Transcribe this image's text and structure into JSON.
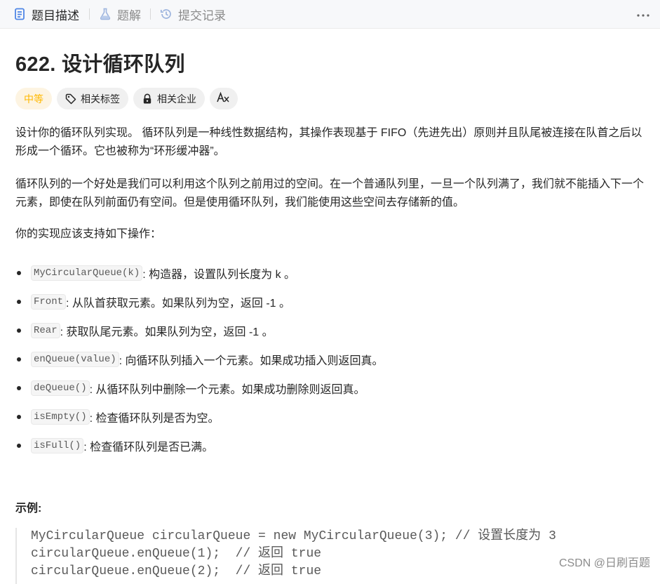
{
  "tabs": [
    {
      "label": "题目描述",
      "icon": "description-icon",
      "active": true
    },
    {
      "label": "题解",
      "icon": "flask-icon",
      "active": false
    },
    {
      "label": "提交记录",
      "icon": "history-icon",
      "active": false
    }
  ],
  "more_icon": "more-dots-icon",
  "problem": {
    "title": "622. 设计循环队列",
    "difficulty": "中等",
    "tags": [
      {
        "label": "相关标签",
        "icon": "tag-icon"
      },
      {
        "label": "相关企业",
        "icon": "lock-icon"
      }
    ],
    "translate_icon": "translate-icon"
  },
  "description": {
    "p1": "设计你的循环队列实现。 循环队列是一种线性数据结构，其操作表现基于 FIFO（先进先出）原则并且队尾被连接在队首之后以形成一个循环。它也被称为“环形缓冲器”。",
    "p2": "循环队列的一个好处是我们可以利用这个队列之前用过的空间。在一个普通队列里，一旦一个队列满了，我们就不能插入下一个元素，即使在队列前面仍有空间。但是使用循环队列，我们能使用这些空间去存储新的值。",
    "p3": "你的实现应该支持如下操作：",
    "operations": [
      {
        "code": "MyCircularQueue(k)",
        "text": ": 构造器，设置队列长度为 k 。"
      },
      {
        "code": "Front",
        "text": ": 从队首获取元素。如果队列为空，返回 -1 。"
      },
      {
        "code": "Rear",
        "text": ": 获取队尾元素。如果队列为空，返回 -1 。"
      },
      {
        "code": "enQueue(value)",
        "text": ": 向循环队列插入一个元素。如果成功插入则返回真。"
      },
      {
        "code": "deQueue()",
        "text": ": 从循环队列中删除一个元素。如果成功删除则返回真。"
      },
      {
        "code": "isEmpty()",
        "text": ": 检查循环队列是否为空。"
      },
      {
        "code": "isFull()",
        "text": ": 检查循环队列是否已满。"
      }
    ]
  },
  "example": {
    "heading": "示例:",
    "code_lines": [
      "MyCircularQueue circularQueue = new MyCircularQueue(3); // 设置长度为 3",
      "circularQueue.enQueue(1);  // 返回 true",
      "circularQueue.enQueue(2);  // 返回 true"
    ]
  },
  "watermark": "CSDN @日刷百题",
  "colors": {
    "difficulty": "#ffb800",
    "text": "#262626",
    "muted": "#8a8a8a"
  }
}
